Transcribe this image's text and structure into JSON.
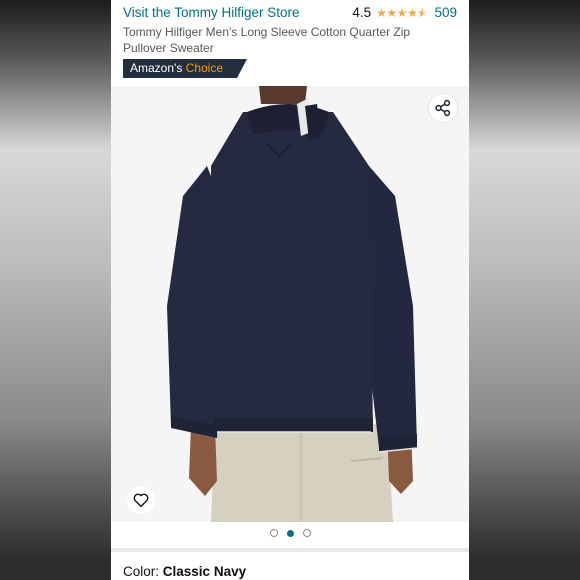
{
  "product": {
    "store_link": "Visit the Tommy Hilfiger Store",
    "rating": "4.5",
    "stars_value": 4.5,
    "review_count": "509",
    "title": "Tommy Hilfiger Men's Long Sleeve Cotton Quarter Zip Pullover Sweater",
    "badge": {
      "prefix": "Amazon's",
      "highlight": "Choice"
    }
  },
  "gallery": {
    "image_alt": "navy quarter zip sweater back view",
    "dot_count": 3,
    "active_dot": 2,
    "share_icon": "share-icon",
    "wishlist_icon": "heart-icon"
  },
  "options": {
    "color_label": "Color:",
    "color_value": "Classic Navy"
  },
  "colors": {
    "link": "#007185",
    "badge_bg": "#232f3e",
    "badge_accent": "#ff9900",
    "star": "#f3a847",
    "sweater": "#262a40"
  }
}
